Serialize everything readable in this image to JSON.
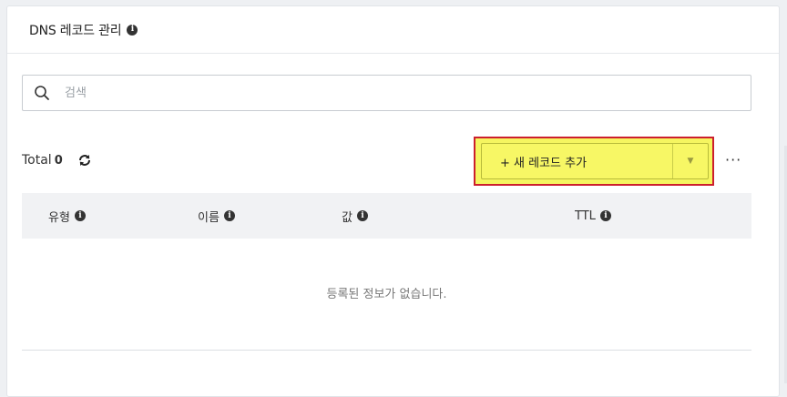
{
  "panel": {
    "title": "DNS 레코드 관리",
    "info_icon": "info-circle-icon"
  },
  "search": {
    "placeholder": "검색",
    "value": "",
    "icon": "search-icon"
  },
  "summary": {
    "total_label": "Total",
    "total_count": "0",
    "refresh_icon": "refresh-icon"
  },
  "toolbar": {
    "add_record_label": "+ 새 레코드 추가",
    "dropdown_caret": "▼",
    "more_label": "···"
  },
  "table": {
    "columns": [
      {
        "label": "유형"
      },
      {
        "label": "이름"
      },
      {
        "label": "값"
      },
      {
        "label": "TTL"
      }
    ],
    "empty_message": "등록된 정보가 없습니다."
  },
  "colors": {
    "highlight": "#f5f560",
    "highlight_border": "#cc1f2d",
    "table_header_bg": "#f1f2f4"
  }
}
